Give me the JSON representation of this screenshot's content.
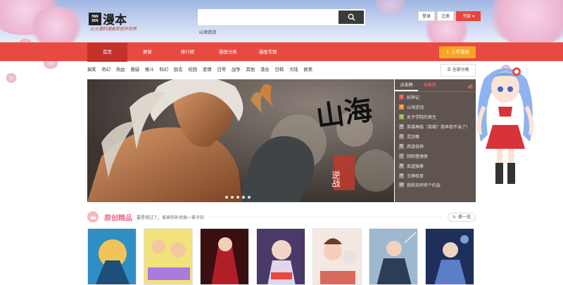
{
  "logo": {
    "mark_lines": [
      "MAN",
      "BEN"
    ],
    "text": "漫本",
    "slogan": "让火漫的漫画家创作世界"
  },
  "search": {
    "value": "",
    "placeholder": "",
    "hot_word": "山海逆战"
  },
  "userbar": {
    "login": "登录",
    "register": "注册",
    "bookshelf": "书架"
  },
  "nav": {
    "items": [
      "首页",
      "更新",
      "排行榜",
      "漫画分类",
      "漫画专题"
    ],
    "active": "首页",
    "upload": "上传漫画"
  },
  "categories": [
    "搞笑",
    "奇幻",
    "热血",
    "悬疑",
    "格斗",
    "科幻",
    "励志",
    "校园",
    "爱情",
    "日常",
    "战争",
    "其他",
    "港台",
    "日韩",
    "大陆",
    "欧美"
  ],
  "all_categories": "全部分类",
  "banner": {
    "title_text": "山海",
    "subtitle_text": "逆战",
    "slides": 5
  },
  "rank": {
    "tabs": [
      "点击榜",
      "收藏榜"
    ],
    "active_tab": "点击榜",
    "items": [
      {
        "num": "1",
        "title": "妖神记"
      },
      {
        "num": "2",
        "title": "山海逆战"
      },
      {
        "num": "3",
        "title": "女子学院的男生"
      },
      {
        "num": "4",
        "title": "英雄再临（英雄？我早就不当了）"
      },
      {
        "num": "5",
        "title": "灵剑尊"
      },
      {
        "num": "6",
        "title": "西游虫神"
      },
      {
        "num": "7",
        "title": "阴阳借魂使"
      },
      {
        "num": "8",
        "title": "武道独尊"
      },
      {
        "num": "9",
        "title": "王牌校草"
      },
      {
        "num": "10",
        "title": "我和天师有个约会"
      }
    ]
  },
  "section": {
    "title": "原创精品",
    "subtitle": "要是错过了，谁来弥补后悔一辈子的",
    "refresh": "换一批"
  },
  "colors": {
    "nav_red": "#e84a42",
    "nav_active": "#c4322b",
    "upload_orange": "#f6a623",
    "section_pink": "#f06b8a",
    "rank_bg": "#5f5450"
  },
  "icons": {
    "search": "magnifier-icon",
    "upload": "upload-icon",
    "menu": "list-icon",
    "refresh": "refresh-icon",
    "section": "crown-icon",
    "rank": "bar-chart-icon"
  }
}
